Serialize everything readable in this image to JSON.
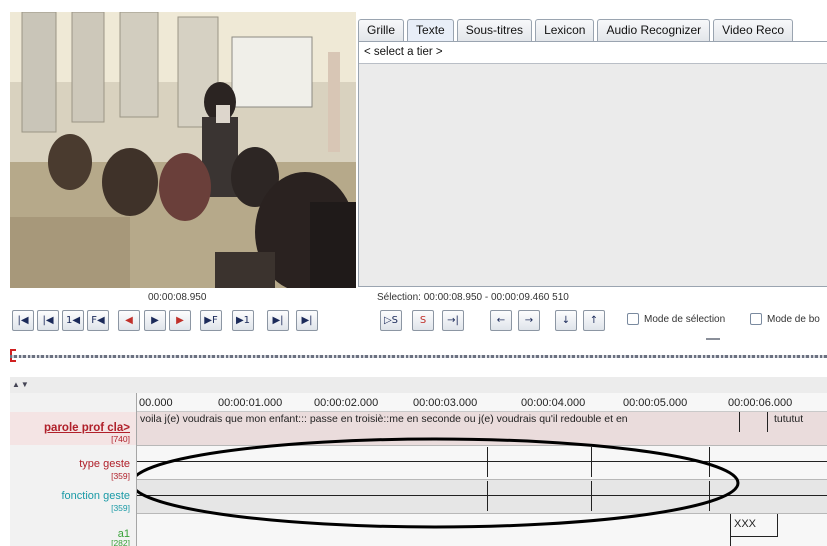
{
  "tabs": [
    "Grille",
    "Texte",
    "Sous-titres",
    "Lexicon",
    "Audio Recognizer",
    "Video Reco"
  ],
  "tier_select": "< select a tier >",
  "media_time": "00:00:08.950",
  "selection": "Sélection: 00:00:08.950 - 00:00:09.460  510",
  "player_buttons": [
    "|◀",
    "|◀",
    "1◀",
    "F◀",
    "◀",
    "▶",
    "▶",
    "▶F",
    "▶1",
    "▶|",
    "▶|"
  ],
  "selection_buttons": [
    "▷S",
    "S",
    "→|",
    "←",
    "→",
    "↓",
    "↑"
  ],
  "checkboxes": [
    "Mode de sélection",
    "Mode de bo"
  ],
  "time_ruler": [
    "00.000",
    "00:00:01.000",
    "00:00:02.000",
    "00:00:03.000",
    "00:00:04.000",
    "00:00:05.000",
    "00:00:06.000"
  ],
  "tiers": [
    {
      "name": "parole prof cla>",
      "count": "[740]",
      "color": "#b0202a"
    },
    {
      "name": "type geste",
      "count": "[359]",
      "color": "#b0202a"
    },
    {
      "name": "fonction geste",
      "count": "[359]",
      "color": "#1a9aa6"
    },
    {
      "name": "a1",
      "count": "[282]",
      "color": "#3aa23a"
    }
  ],
  "annotations": {
    "main_utterance": "voila j(e) voudrais que mon enfant::: passe en troisiè::me en seconde ou j(e) voudrais qu'il redouble et en",
    "second_segment": "tututut",
    "a1_segment": "XXX"
  }
}
